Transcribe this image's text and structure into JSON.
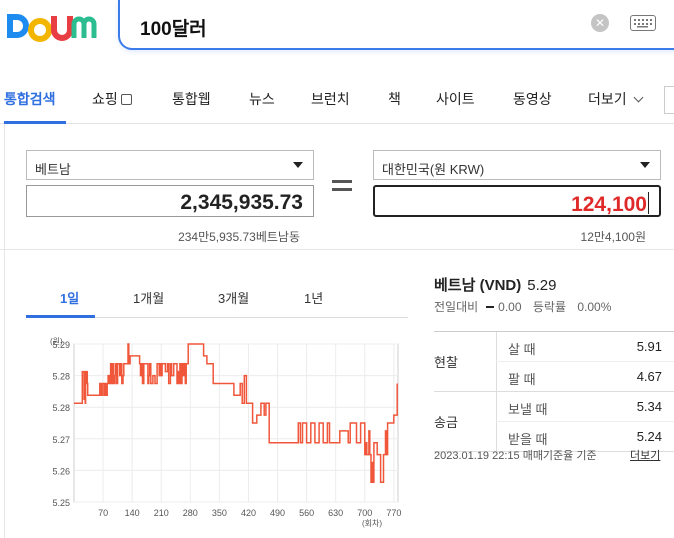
{
  "logo": {
    "text": "Daum",
    "colors": [
      "#1e8cef",
      "#f3b600",
      "#e83d42",
      "#2bbd8f",
      "#9356d6"
    ]
  },
  "search": {
    "query": "100달러"
  },
  "tabs": [
    {
      "label": "통합검색",
      "active": true
    },
    {
      "label": "쇼핑"
    },
    {
      "label": "통합웹"
    },
    {
      "label": "뉴스"
    },
    {
      "label": "브런치"
    },
    {
      "label": "책"
    },
    {
      "label": "사이트"
    },
    {
      "label": "동영상"
    },
    {
      "label": "더보기"
    }
  ],
  "converter": {
    "from_currency": "베트남",
    "from_amount": "2,345,935.73",
    "from_reading": "234만5,935.73베트남동",
    "to_currency": "대한민국(원 KRW)",
    "to_amount": "124,100",
    "to_reading": "12만4,100원"
  },
  "periods": [
    {
      "label": "1일",
      "active": true
    },
    {
      "label": "1개월"
    },
    {
      "label": "3개월"
    },
    {
      "label": "1년"
    }
  ],
  "info": {
    "title": "베트남 (VND)",
    "rate": "5.29",
    "change_label": "전일대비",
    "change_value": "0.00",
    "pct_label": "등락률",
    "pct_value": "0.00%",
    "groups": [
      {
        "name": "현찰",
        "rows": [
          {
            "label": "살 때",
            "value": "5.91"
          },
          {
            "label": "팔 때",
            "value": "4.67"
          }
        ]
      },
      {
        "name": "송금",
        "rows": [
          {
            "label": "보낼 때",
            "value": "5.34"
          },
          {
            "label": "받을 때",
            "value": "5.24"
          }
        ]
      }
    ],
    "footnote": "2023.01.19 22:15 매매기준율 기준",
    "more_link": "더보기"
  },
  "chart_data": {
    "type": "line",
    "ylabel": "(원)",
    "xlabel": "(회차)",
    "y_ticks": [
      "5.29",
      "5.28",
      "5.28",
      "5.27",
      "5.26",
      "5.25"
    ],
    "x_ticks": [
      "70",
      "140",
      "210",
      "280",
      "350",
      "420",
      "490",
      "560",
      "630",
      "700",
      "770"
    ],
    "ylim": [
      5.25,
      5.29
    ],
    "xlim": [
      0,
      780
    ],
    "grid": true,
    "line_color": "#f0573a",
    "x": [
      0,
      18,
      20,
      24,
      25,
      27,
      28,
      30,
      32,
      33,
      60,
      62,
      65,
      68,
      72,
      75,
      78,
      80,
      82,
      85,
      88,
      90,
      92,
      95,
      98,
      100,
      102,
      105,
      110,
      112,
      115,
      118,
      120,
      128,
      130,
      132,
      135,
      155,
      158,
      160,
      162,
      165,
      168,
      175,
      178,
      180,
      182,
      185,
      190,
      195,
      200,
      205,
      208,
      210,
      212,
      215,
      220,
      225,
      228,
      232,
      235,
      240,
      245,
      248,
      250,
      252,
      255,
      258,
      260,
      262,
      265,
      268,
      270,
      272,
      275,
      280,
      300,
      312,
      315,
      318,
      320,
      325,
      330,
      335,
      340,
      380,
      385,
      395,
      400,
      405,
      410,
      415,
      420,
      430,
      440,
      450,
      458,
      462,
      470,
      478,
      520,
      530,
      540,
      545,
      550,
      560,
      570,
      580,
      590,
      600,
      610,
      615,
      620,
      630,
      640,
      660,
      665,
      680,
      690,
      700,
      702,
      705,
      710,
      712,
      715,
      718,
      720,
      722,
      730,
      735,
      738,
      745,
      750,
      752,
      755,
      770,
      778
    ],
    "y": [
      5.275,
      5.275,
      5.283,
      5.276,
      5.283,
      5.275,
      5.28,
      5.283,
      5.28,
      5.277,
      5.277,
      5.28,
      5.277,
      5.28,
      5.277,
      5.28,
      5.277,
      5.28,
      5.282,
      5.28,
      5.285,
      5.28,
      5.285,
      5.28,
      5.282,
      5.285,
      5.28,
      5.285,
      5.282,
      5.285,
      5.28,
      5.282,
      5.285,
      5.285,
      5.29,
      5.285,
      5.287,
      5.287,
      5.285,
      5.282,
      5.285,
      5.28,
      5.285,
      5.285,
      5.28,
      5.282,
      5.285,
      5.28,
      5.282,
      5.28,
      5.285,
      5.282,
      5.285,
      5.282,
      5.285,
      5.285,
      5.283,
      5.285,
      5.28,
      5.285,
      5.282,
      5.285,
      5.285,
      5.28,
      5.283,
      5.28,
      5.285,
      5.28,
      5.285,
      5.282,
      5.285,
      5.28,
      5.285,
      5.285,
      5.29,
      5.29,
      5.29,
      5.287,
      5.287,
      5.287,
      5.285,
      5.285,
      5.285,
      5.28,
      5.28,
      5.28,
      5.277,
      5.277,
      5.28,
      5.275,
      5.282,
      5.275,
      5.275,
      5.27,
      5.272,
      5.275,
      5.272,
      5.275,
      5.265,
      5.265,
      5.265,
      5.265,
      5.27,
      5.265,
      5.27,
      5.265,
      5.27,
      5.265,
      5.27,
      5.265,
      5.27,
      5.265,
      5.265,
      5.265,
      5.268,
      5.265,
      5.27,
      5.265,
      5.27,
      5.262,
      5.265,
      5.262,
      5.268,
      5.262,
      5.255,
      5.26,
      5.255,
      5.265,
      5.262,
      5.262,
      5.255,
      5.262,
      5.268,
      5.262,
      5.27,
      5.272,
      5.28
    ]
  }
}
